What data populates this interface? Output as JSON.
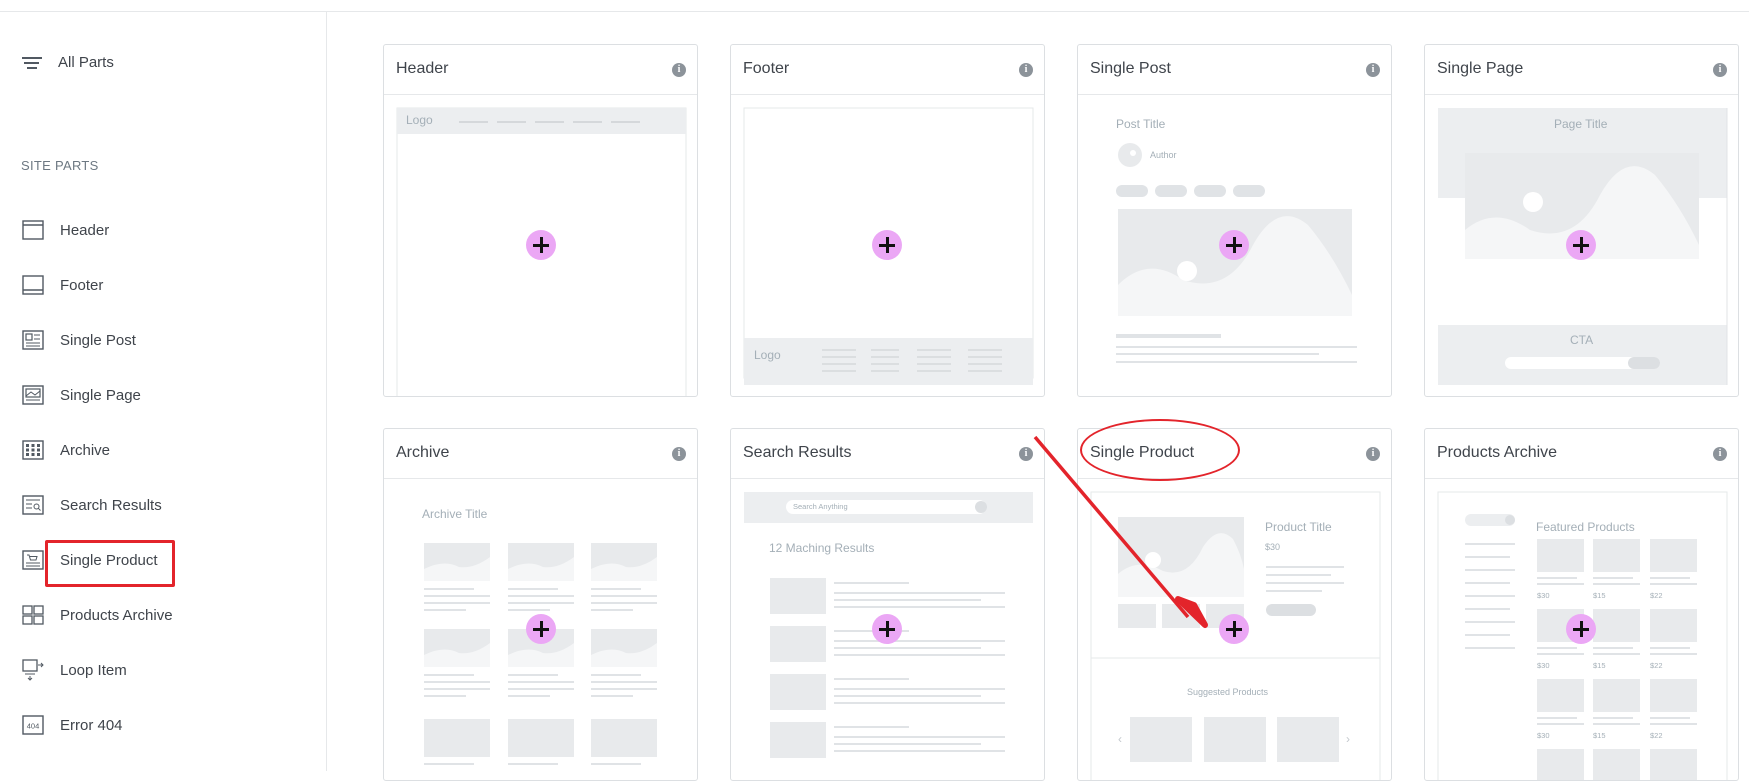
{
  "sidebar": {
    "all_parts_label": "All Parts",
    "section_title": "SITE PARTS",
    "items": [
      {
        "label": "Header",
        "icon": "header-icon"
      },
      {
        "label": "Footer",
        "icon": "footer-icon"
      },
      {
        "label": "Single Post",
        "icon": "single-post-icon"
      },
      {
        "label": "Single Page",
        "icon": "single-page-icon"
      },
      {
        "label": "Archive",
        "icon": "archive-icon"
      },
      {
        "label": "Search Results",
        "icon": "search-results-icon"
      },
      {
        "label": "Single Product",
        "icon": "single-product-icon"
      },
      {
        "label": "Products Archive",
        "icon": "products-archive-icon"
      },
      {
        "label": "Loop Item",
        "icon": "loop-item-icon"
      },
      {
        "label": "Error 404",
        "icon": "error-404-icon"
      }
    ]
  },
  "cards": [
    {
      "title": "Header",
      "preview": {
        "logo": "Logo"
      }
    },
    {
      "title": "Footer",
      "preview": {
        "logo": "Logo"
      }
    },
    {
      "title": "Single Post",
      "preview": {
        "post_title": "Post Title",
        "author": "Author"
      }
    },
    {
      "title": "Single Page",
      "preview": {
        "page_title": "Page Title",
        "cta": "CTA"
      }
    },
    {
      "title": "Archive",
      "preview": {
        "archive_title": "Archive Title"
      }
    },
    {
      "title": "Search Results",
      "preview": {
        "search_placeholder": "Search Anything",
        "results": "12 Maching Results"
      }
    },
    {
      "title": "Single Product",
      "preview": {
        "product_title": "Product Title",
        "price": "$30",
        "suggested": "Suggested Products"
      }
    },
    {
      "title": "Products Archive",
      "preview": {
        "featured": "Featured Products",
        "prices": [
          "$30",
          "$15",
          "$22"
        ]
      }
    }
  ],
  "colors": {
    "highlight": "#e3242b",
    "add_button": "#eba7f5",
    "placeholder_gray": "#e8eaec",
    "info_icon": "#8c939a"
  }
}
